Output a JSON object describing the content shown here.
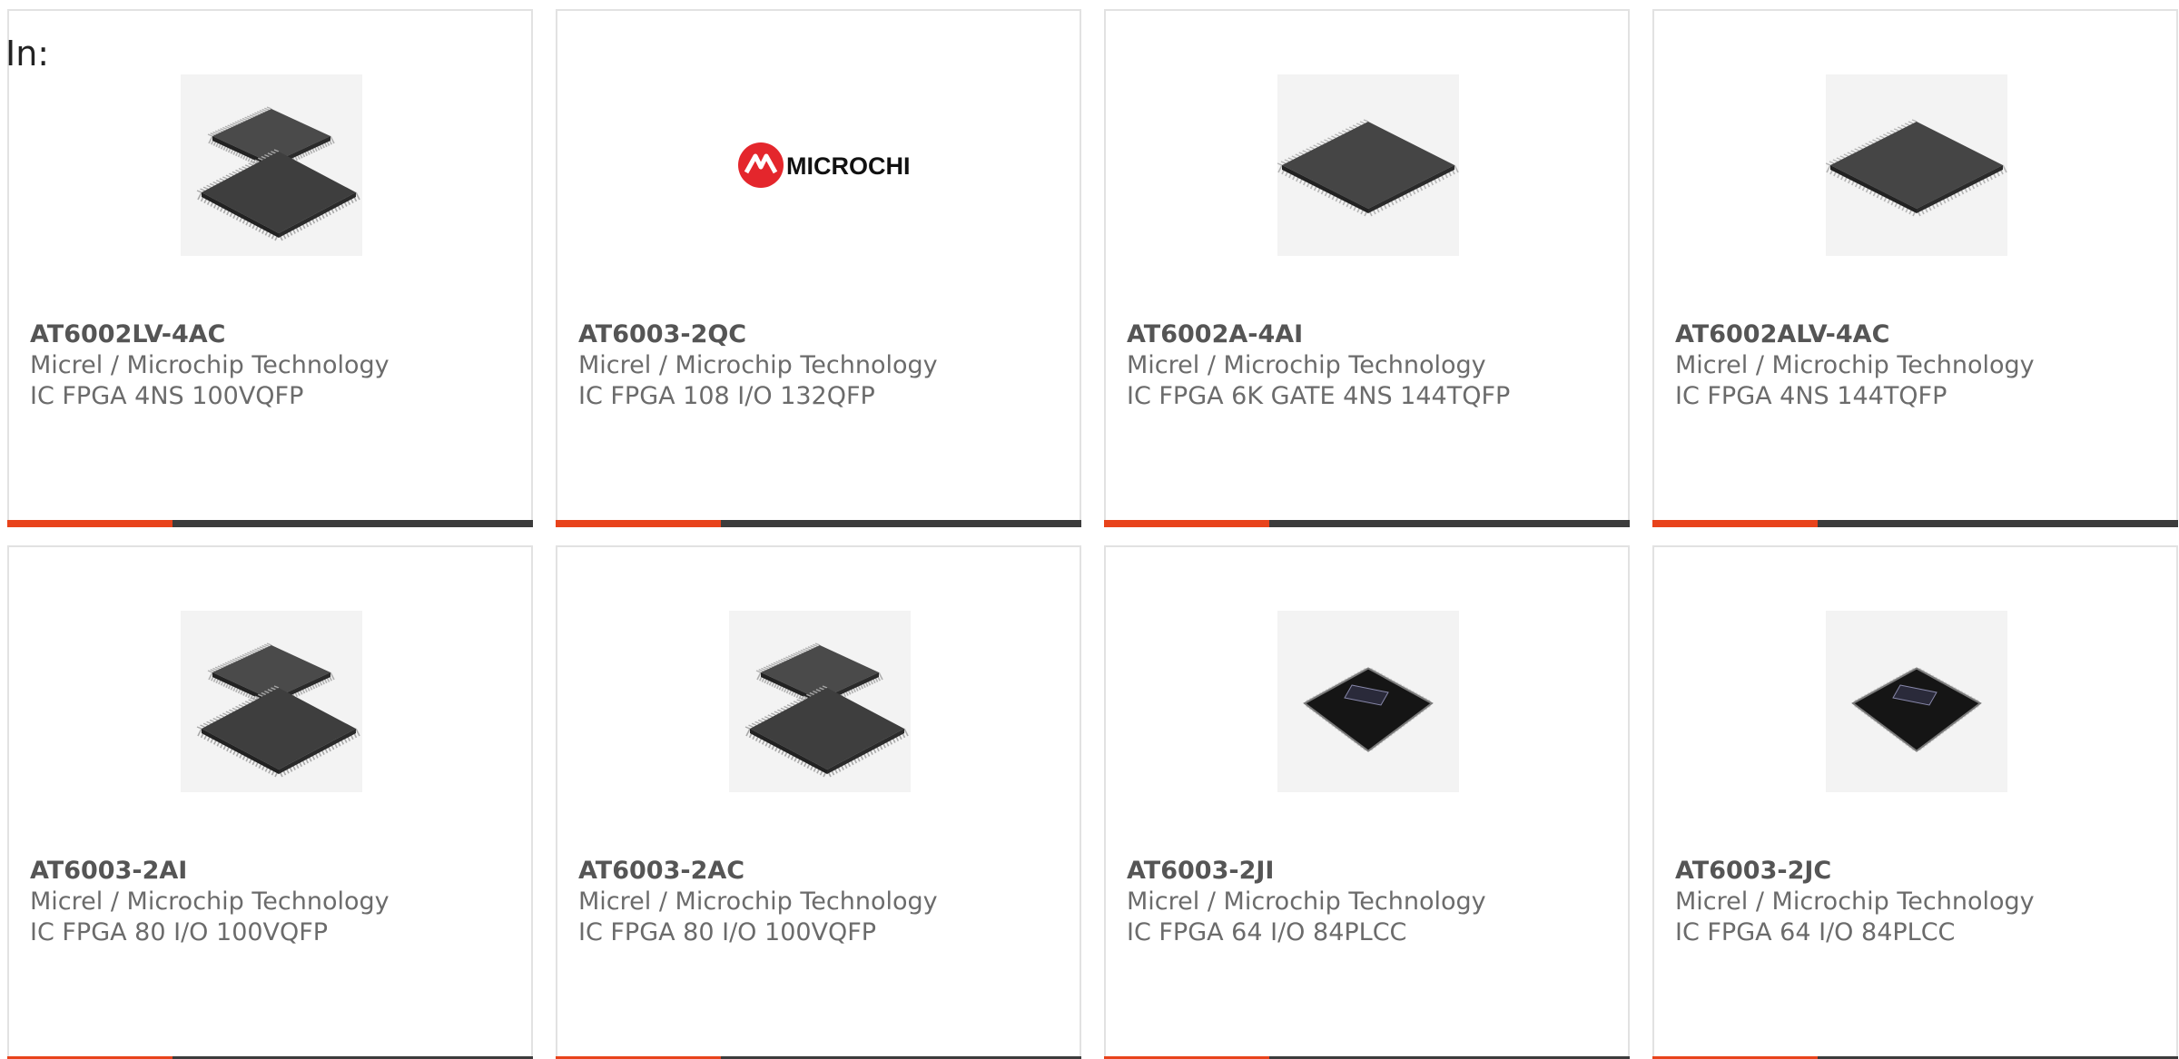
{
  "filter_label": "In:",
  "colors": {
    "accent": "#e8431b",
    "bar_dark": "#3c3c3c",
    "card_border": "#e2e2e2",
    "text_gray": "#6b6b6b",
    "microchip_red": "#e4262c"
  },
  "products": [
    {
      "part": "AT6002LV-4AC",
      "manufacturer": "Micrel / Microchip Technology",
      "description": "IC FPGA 4NS 100VQFP",
      "image": "qfp-chip-pair-icon"
    },
    {
      "part": "AT6003-2QC",
      "manufacturer": "Micrel / Microchip Technology",
      "description": "IC FPGA 108 I/O 132QFP",
      "image": "microchip-logo",
      "logo_text": "MICROCHIP"
    },
    {
      "part": "AT6002A-4AI",
      "manufacturer": "Micrel / Microchip Technology",
      "description": "IC FPGA 6K GATE 4NS 144TQFP",
      "image": "tqfp-chip-icon"
    },
    {
      "part": "AT6002ALV-4AC",
      "manufacturer": "Micrel / Microchip Technology",
      "description": "IC FPGA 4NS 144TQFP",
      "image": "tqfp-chip-icon"
    },
    {
      "part": "AT6003-2AI",
      "manufacturer": "Micrel / Microchip Technology",
      "description": "IC FPGA 80 I/O 100VQFP",
      "image": "qfp-chip-pair-icon"
    },
    {
      "part": "AT6003-2AC",
      "manufacturer": "Micrel / Microchip Technology",
      "description": "IC FPGA 80 I/O 100VQFP",
      "image": "qfp-chip-pair-icon"
    },
    {
      "part": "AT6003-2JI",
      "manufacturer": "Micrel / Microchip Technology",
      "description": "IC FPGA 64 I/O 84PLCC",
      "image": "plcc-chip-icon"
    },
    {
      "part": "AT6003-2JC",
      "manufacturer": "Micrel / Microchip Technology",
      "description": "IC FPGA 64 I/O 84PLCC",
      "image": "plcc-chip-icon"
    }
  ]
}
